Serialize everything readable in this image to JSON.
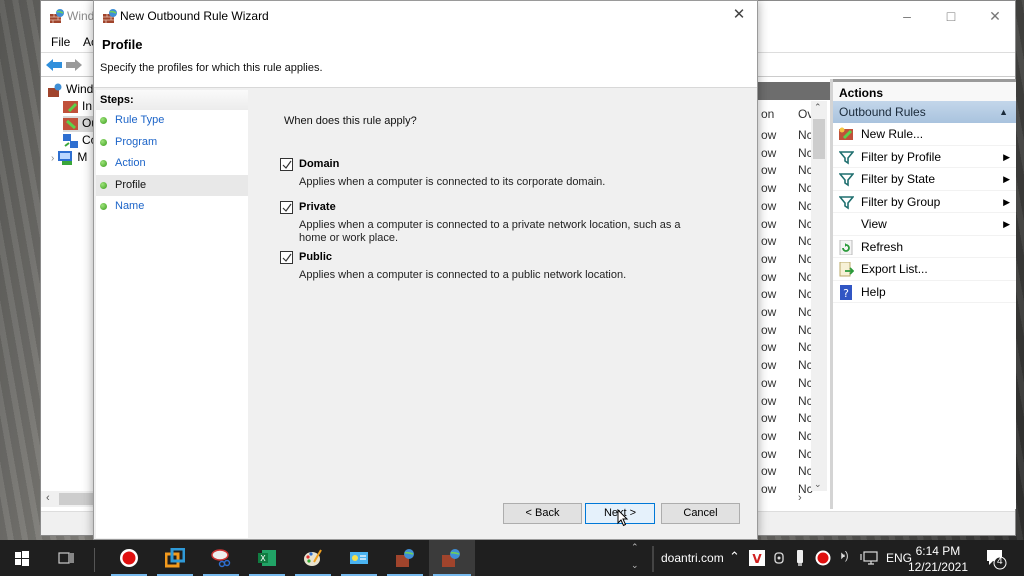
{
  "background_window": {
    "title": "Windows Defender Firewall with Advanced Security",
    "title_visible": "Wind",
    "menu": [
      "File",
      "Action"
    ],
    "menu_visible": [
      "File",
      "Ac"
    ],
    "tree": [
      {
        "label": "Windows Defender Firewall",
        "visible": "Wind"
      },
      {
        "label": "Inbound Rules",
        "visible": "In"
      },
      {
        "label": "Outbound Rules",
        "visible": "Ou",
        "selected": true
      },
      {
        "label": "Connection Security Rules",
        "visible": "Co"
      },
      {
        "label": "Monitoring",
        "visible": "M"
      }
    ],
    "list": {
      "col_action": "on",
      "col_override": "Ov",
      "row_action": "ow",
      "row_override": "Nc",
      "row_count": 21
    },
    "actions": {
      "header": "Actions",
      "section": "Outbound Rules",
      "items": [
        {
          "label": "New Rule...",
          "icon": "new-rule-icon",
          "submenu": false
        },
        {
          "label": "Filter by Profile",
          "icon": "filter-icon",
          "submenu": true
        },
        {
          "label": "Filter by State",
          "icon": "filter-icon",
          "submenu": true
        },
        {
          "label": "Filter by Group",
          "icon": "filter-icon",
          "submenu": true
        },
        {
          "label": "View",
          "icon": "",
          "submenu": true
        },
        {
          "label": "Refresh",
          "icon": "refresh-icon",
          "submenu": false
        },
        {
          "label": "Export List...",
          "icon": "export-icon",
          "submenu": false
        },
        {
          "label": "Help",
          "icon": "help-icon",
          "submenu": false
        }
      ]
    }
  },
  "wizard": {
    "title": "New Outbound Rule Wizard",
    "heading": "Profile",
    "description": "Specify the profiles for which this rule applies.",
    "steps_header": "Steps:",
    "steps": [
      {
        "label": "Rule Type",
        "current": false
      },
      {
        "label": "Program",
        "current": false
      },
      {
        "label": "Action",
        "current": false
      },
      {
        "label": "Profile",
        "current": true
      },
      {
        "label": "Name",
        "current": false
      }
    ],
    "question": "When does this rule apply?",
    "options": [
      {
        "label": "Domain",
        "checked": true,
        "description": "Applies when a computer is connected to its corporate domain."
      },
      {
        "label": "Private",
        "checked": true,
        "description": "Applies when a computer is connected to a private network location, such as a home or work place."
      },
      {
        "label": "Public",
        "checked": true,
        "description": "Applies when a computer is connected to a public network location."
      }
    ],
    "buttons": {
      "back": "< Back",
      "next": "Next >",
      "cancel": "Cancel"
    }
  },
  "taskbar": {
    "apps": [
      "start",
      "task-view",
      "screen-recorder",
      "vmware",
      "snipping-tool",
      "excel",
      "paint",
      "control-panel",
      "firewall",
      "firewall-wizard"
    ],
    "tray_label": "doantri.com",
    "language": "ENG",
    "time": "6:14 PM",
    "date": "12/21/2021",
    "notification_count": "4"
  },
  "colors": {
    "link_blue": "#1c64c8",
    "accent": "#0078d7",
    "taskbar": "#1f1f1f",
    "actions_section": "#b6cce4"
  }
}
